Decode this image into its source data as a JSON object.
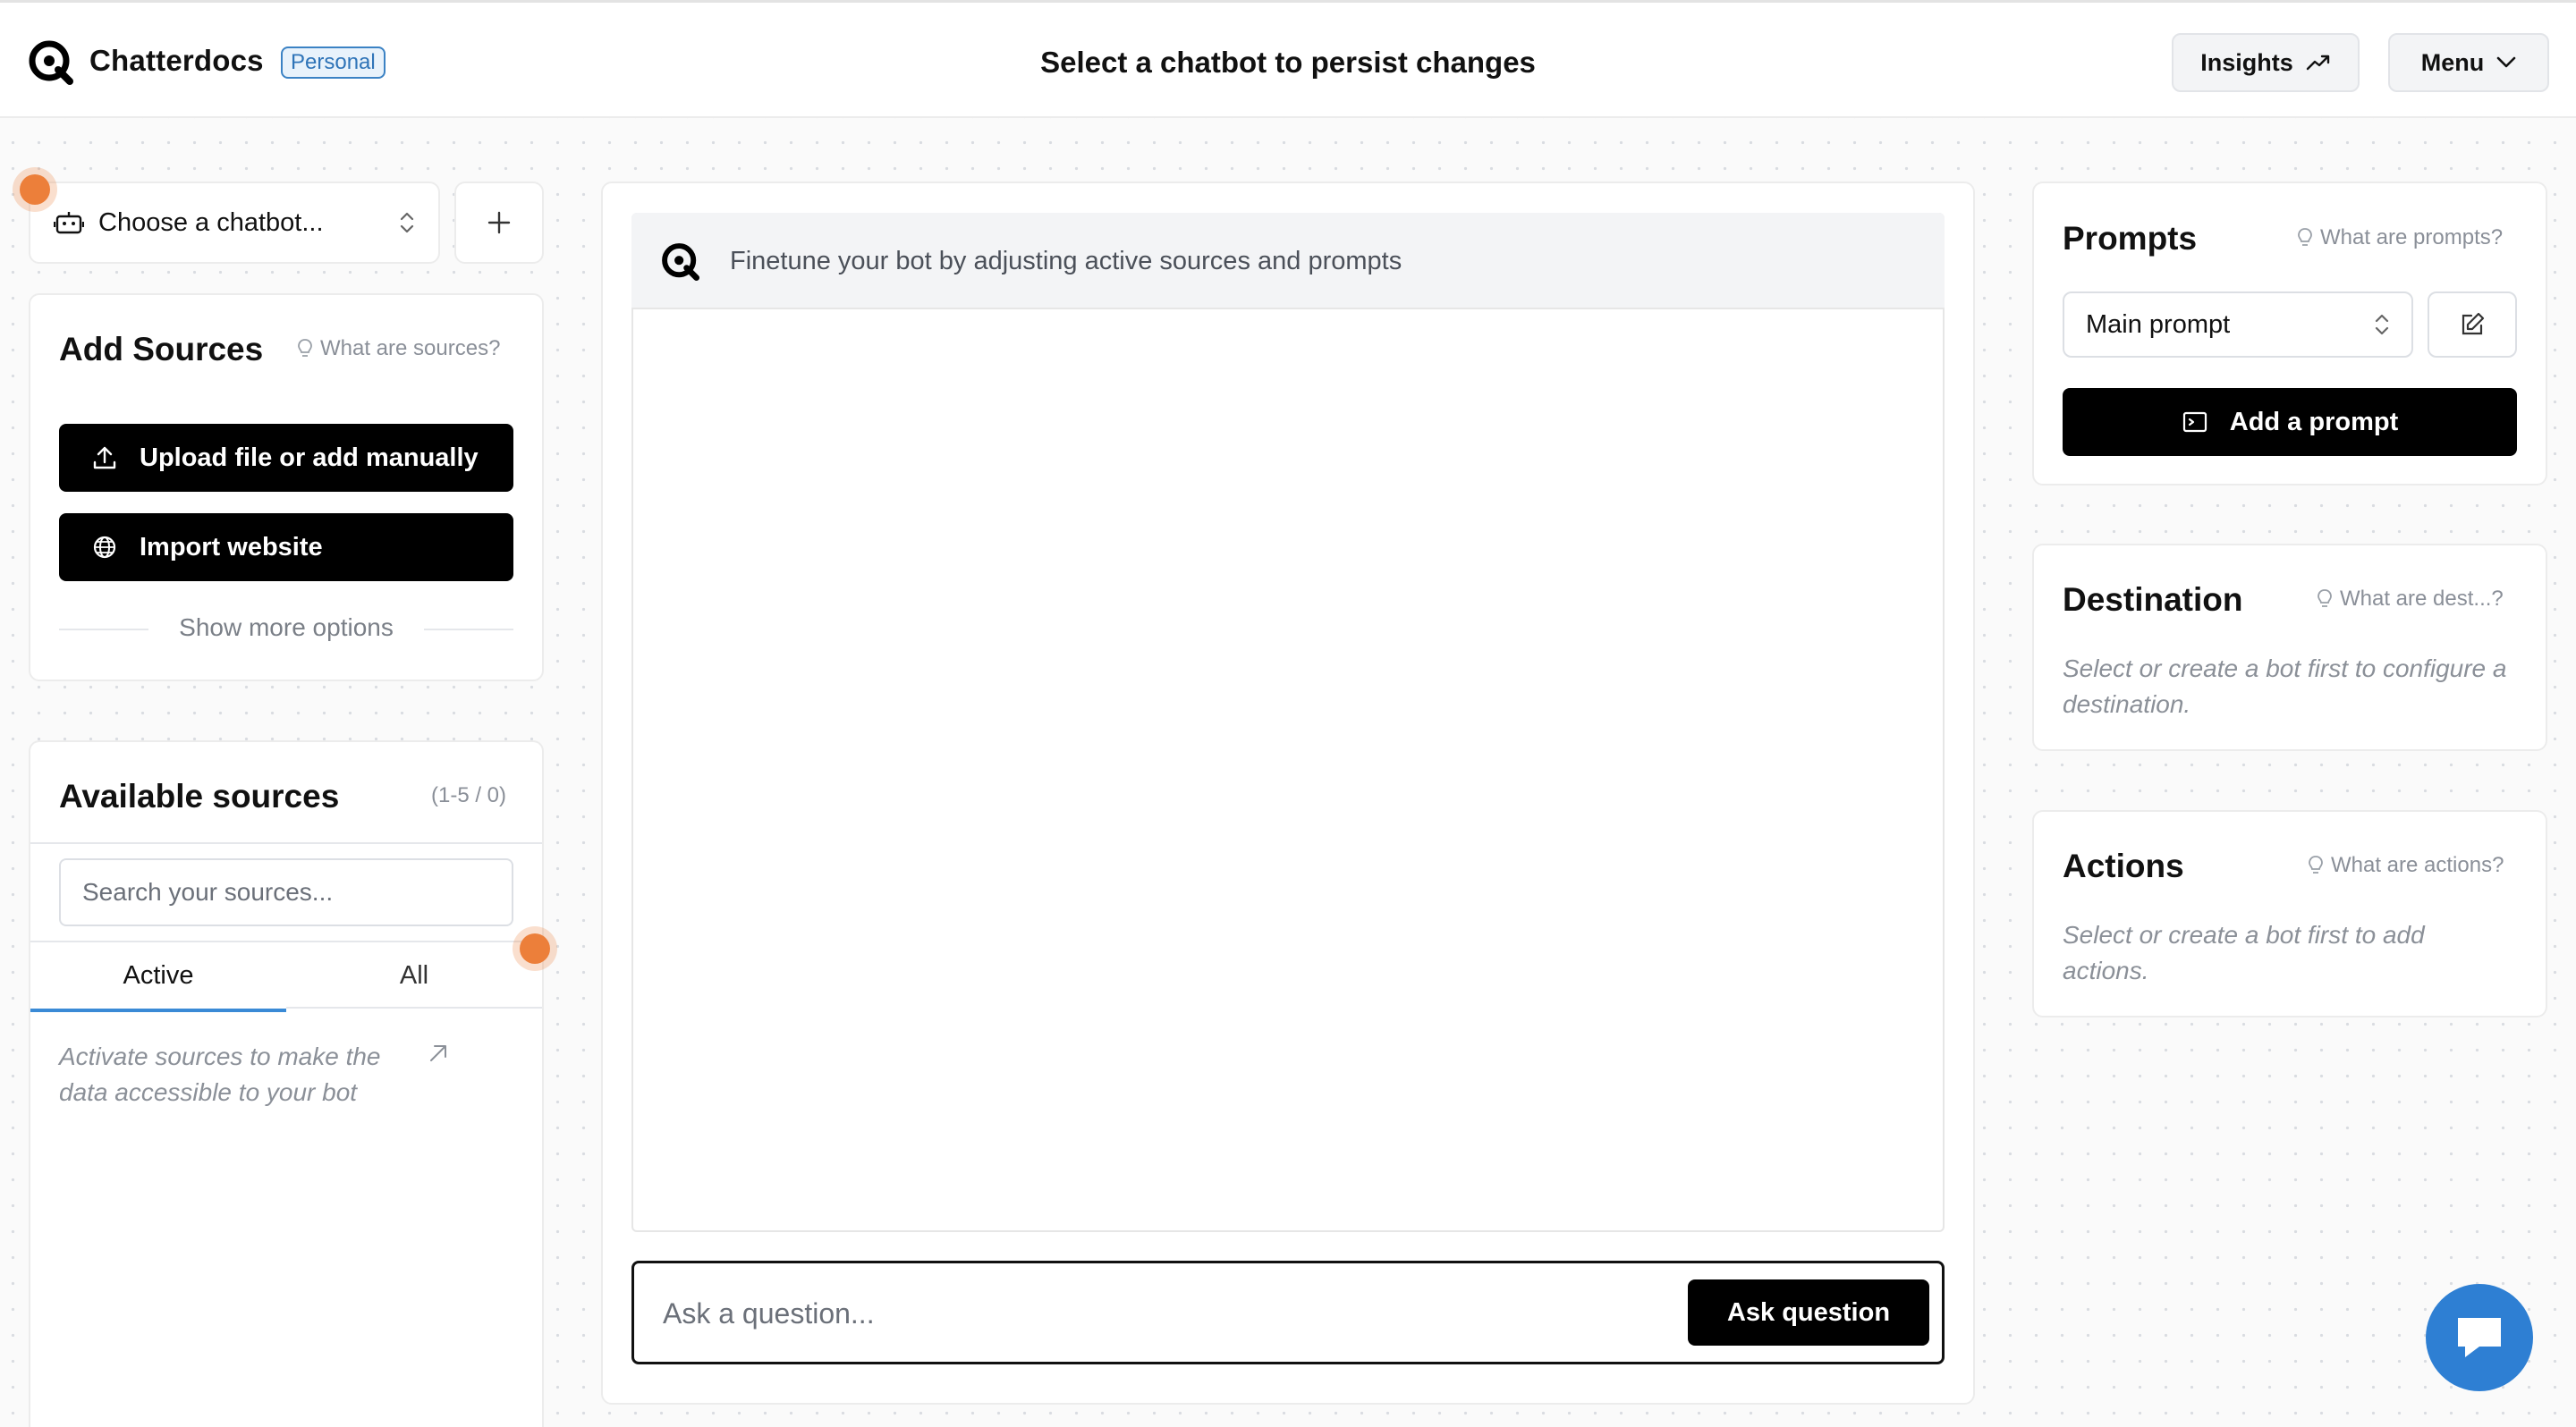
{
  "header": {
    "brand": "Chatterdocs",
    "badge": "Personal",
    "title": "Select a chatbot to persist changes",
    "insights_label": "Insights",
    "menu_label": "Menu"
  },
  "chatbot_selector": {
    "placeholder": "Choose a chatbot..."
  },
  "add_sources": {
    "title": "Add Sources",
    "help": "What are sources?",
    "upload_label": "Upload file or add manually",
    "import_label": "Import website",
    "more_options": "Show more options"
  },
  "available_sources": {
    "title": "Available sources",
    "count": "(1-5 / 0)",
    "search_placeholder": "Search your sources...",
    "tabs": [
      "Active",
      "All"
    ],
    "active_tab": "Active",
    "empty_message": "Activate sources to make the data accessible to your bot"
  },
  "chat": {
    "header_text": "Finetune your bot by adjusting active sources and prompts",
    "input_placeholder": "Ask a question...",
    "ask_label": "Ask question"
  },
  "prompts": {
    "title": "Prompts",
    "help": "What are prompts?",
    "selected": "Main prompt",
    "add_label": "Add a prompt"
  },
  "destination": {
    "title": "Destination",
    "help": "What are dest...?",
    "message": "Select or create a bot first to configure a destination."
  },
  "actions": {
    "title": "Actions",
    "help": "What are actions?",
    "message": "Select or create a bot first to add actions."
  },
  "colors": {
    "accent_badge": "#2f74b8",
    "primary_button": "#000000",
    "fab": "#2e7fd3",
    "tour_dot": "#ec7f3a"
  },
  "icons": [
    "logo-icon",
    "trend-up-icon",
    "chevron-down-icon",
    "robot-icon",
    "sort-icon",
    "plus-icon",
    "bulb-icon",
    "upload-icon",
    "globe-icon",
    "arrow-up-right-icon",
    "edit-icon",
    "terminal-icon",
    "chat-icon"
  ]
}
